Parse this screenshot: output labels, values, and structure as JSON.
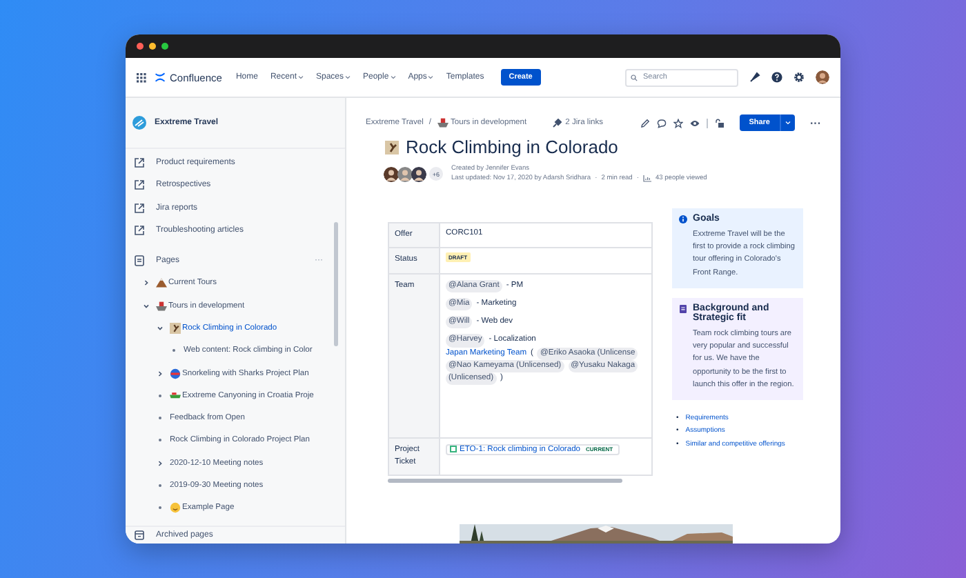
{
  "topnav": {
    "product": "Confluence",
    "links": [
      {
        "label": "Home",
        "dropdown": false
      },
      {
        "label": "Recent",
        "dropdown": true
      },
      {
        "label": "Spaces",
        "dropdown": true
      },
      {
        "label": "People",
        "dropdown": true
      },
      {
        "label": "Apps",
        "dropdown": true
      },
      {
        "label": "Templates",
        "dropdown": false
      }
    ],
    "create": "Create",
    "search": {
      "placeholder": "Search"
    }
  },
  "sidebar": {
    "space": "Exxtreme Travel",
    "shortcuts": [
      "Product requirements",
      "Retrospectives",
      "Jira reports",
      "Troubleshooting articles"
    ],
    "pages_label": "Pages",
    "pages_more": "···",
    "tree": [
      {
        "label": "Current Tours",
        "kind": "branch",
        "expanded": false,
        "selected": false
      },
      {
        "label": "Tours in development",
        "kind": "branch",
        "expanded": true,
        "selected": false,
        "children": [
          {
            "label": "Rock Climbing in Colorado",
            "kind": "branch",
            "expanded": true,
            "selected": true,
            "children": [
              {
                "label": "Web content: Rock climbing in Color",
                "kind": "leaf",
                "selected": false
              }
            ]
          },
          {
            "label": "Snorkeling with Sharks Project Plan",
            "kind": "branch",
            "expanded": false,
            "selected": false
          },
          {
            "label": "Exxtreme Canyoning in Croatia Proje",
            "kind": "leaf",
            "selected": false
          },
          {
            "label": "Feedback from Open",
            "kind": "leaf",
            "selected": false
          },
          {
            "label": "Rock Climbing in Colorado Project Plan",
            "kind": "leaf",
            "selected": false
          },
          {
            "label": "2020-12-10 Meeting notes",
            "kind": "branch",
            "expanded": false,
            "selected": false
          },
          {
            "label": "2019-09-30 Meeting notes",
            "kind": "leaf",
            "selected": false
          },
          {
            "label": "Example Page",
            "kind": "leaf",
            "selected": false
          }
        ]
      }
    ],
    "archived": "Archived pages"
  },
  "breadcrumbs": [
    {
      "label": "Exxtreme Travel"
    },
    {
      "label": "Tours in development"
    }
  ],
  "breadcrumb_separator": "/",
  "jira_links": "2 Jira links",
  "share": "Share",
  "more": "···",
  "page": {
    "title": "Rock Climbing in Colorado",
    "contributors_more": "+6",
    "created": "Created by Jennifer Evans",
    "updated": "Last updated: Nov 17, 2020 by Adarsh Sridhara",
    "dot": "·",
    "read_time": "2 min read",
    "views": "43 people viewed"
  },
  "table": {
    "rows": [
      {
        "label": "Offer",
        "kind": "text",
        "text": "CORC101"
      },
      {
        "label": "Status",
        "kind": "status",
        "text": "DRAFT"
      },
      {
        "label": "Team",
        "kind": "team",
        "lines": [
          [
            {
              "kind": "mention",
              "text": "@Alana Grant"
            },
            {
              "kind": "text",
              "text": "- PM"
            }
          ],
          [
            {
              "kind": "mention",
              "text": "@Mia"
            },
            {
              "kind": "text",
              "text": "- Marketing"
            }
          ],
          [
            {
              "kind": "mention",
              "text": "@Will"
            },
            {
              "kind": "text",
              "text": "- Web dev"
            }
          ],
          [
            {
              "kind": "mention",
              "text": "@Harvey"
            },
            {
              "kind": "text",
              "text": "- Localization"
            }
          ],
          [
            {
              "kind": "link",
              "text": "Japan Marketing Team"
            },
            {
              "kind": "text",
              "text": "("
            },
            {
              "kind": "mention",
              "text": "@Eriko Asaoka (Unlicense"
            }
          ],
          [
            {
              "kind": "mention",
              "text": "@Nao Kameyama (Unlicensed)"
            },
            {
              "kind": "mention",
              "text": "@Yusaku Nakaga"
            }
          ],
          [
            {
              "kind": "mention",
              "text": "(Unlicensed)"
            },
            {
              "kind": "text",
              "text": ")"
            }
          ]
        ]
      },
      {
        "label": "Project Ticket",
        "kind": "ticket",
        "text": "ETO-1: Rock climbing in Colorado",
        "badge": "CURRENT"
      }
    ]
  },
  "panels": [
    {
      "kind": "info",
      "title": "Goals",
      "text": "Exxtreme Travel will be the first to provide a rock climbing tour offering in Colorado's Front Range."
    },
    {
      "kind": "note",
      "title": "Background and Strategic fit",
      "text": "Team rock climbing tours are very popular and successful for us. We have the opportunity to be the first to launch this offer in the region."
    }
  ],
  "link_marker": "•",
  "links": [
    "Requirements",
    "Assumptions",
    "Similar and competitive offerings"
  ]
}
